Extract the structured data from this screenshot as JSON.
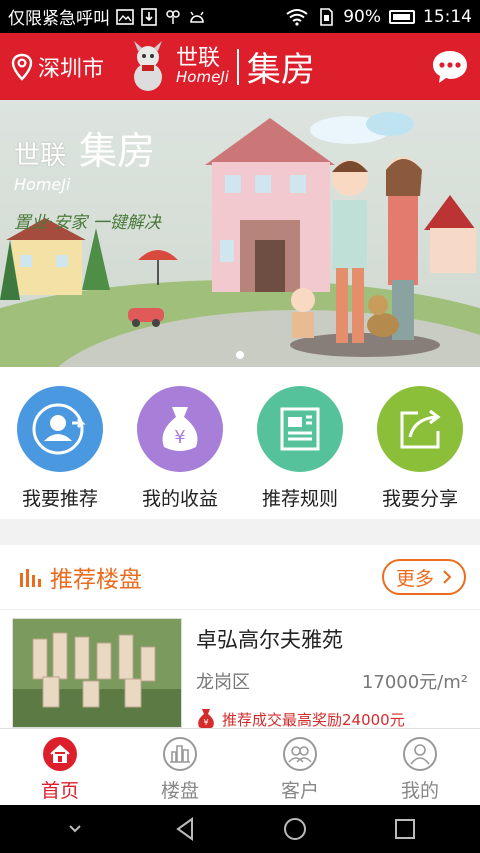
{
  "status_bar": {
    "carrier": "仅限紧急呼叫",
    "battery": "90%",
    "time": "15:14"
  },
  "header": {
    "city": "深圳市",
    "brand_cn": "世联",
    "brand_en": "HomeJi",
    "title": "集房"
  },
  "banner": {
    "brand_cn": "世联",
    "brand_en": "HomeJi",
    "title": "集房",
    "slogan": "置业·安家 一键解决",
    "dots": 1
  },
  "actions": [
    {
      "label": "我要推荐",
      "icon": "user-recommend-icon",
      "color": "#4a98e0"
    },
    {
      "label": "我的收益",
      "icon": "money-bag-icon",
      "color": "#a77fd8"
    },
    {
      "label": "推荐规则",
      "icon": "rules-document-icon",
      "color": "#56c29c"
    },
    {
      "label": "我要分享",
      "icon": "share-icon",
      "color": "#8bbf3a"
    }
  ],
  "section": {
    "title": "推荐楼盘",
    "more": "更多",
    "listing": {
      "name": "卓弘高尔夫雅苑",
      "district": "龙岗区",
      "price": "17000元/m²",
      "reward": "推荐成交最高奖励24000元"
    }
  },
  "tabs": [
    {
      "label": "首页",
      "icon": "home-icon",
      "active": true
    },
    {
      "label": "楼盘",
      "icon": "building-icon",
      "active": false
    },
    {
      "label": "客户",
      "icon": "customers-icon",
      "active": false
    },
    {
      "label": "我的",
      "icon": "profile-icon",
      "active": false
    }
  ],
  "colors": {
    "brand_red": "#dc1f2b",
    "accent_orange": "#ec6c1f"
  }
}
